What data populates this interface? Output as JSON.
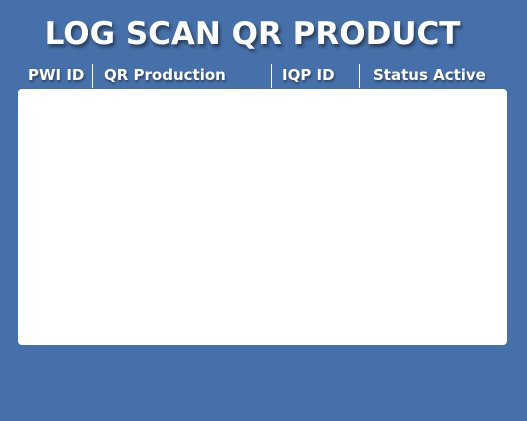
{
  "page": {
    "title": "LOG SCAN QR PRODUCT"
  },
  "table": {
    "columns": [
      {
        "label": "PWI ID"
      },
      {
        "label": "QR Production"
      },
      {
        "label": "IQP ID"
      },
      {
        "label": "Status Active"
      }
    ],
    "rows": []
  },
  "colors": {
    "background": "#4670a9",
    "panel": "#ffffff",
    "text": "#ffffff"
  }
}
